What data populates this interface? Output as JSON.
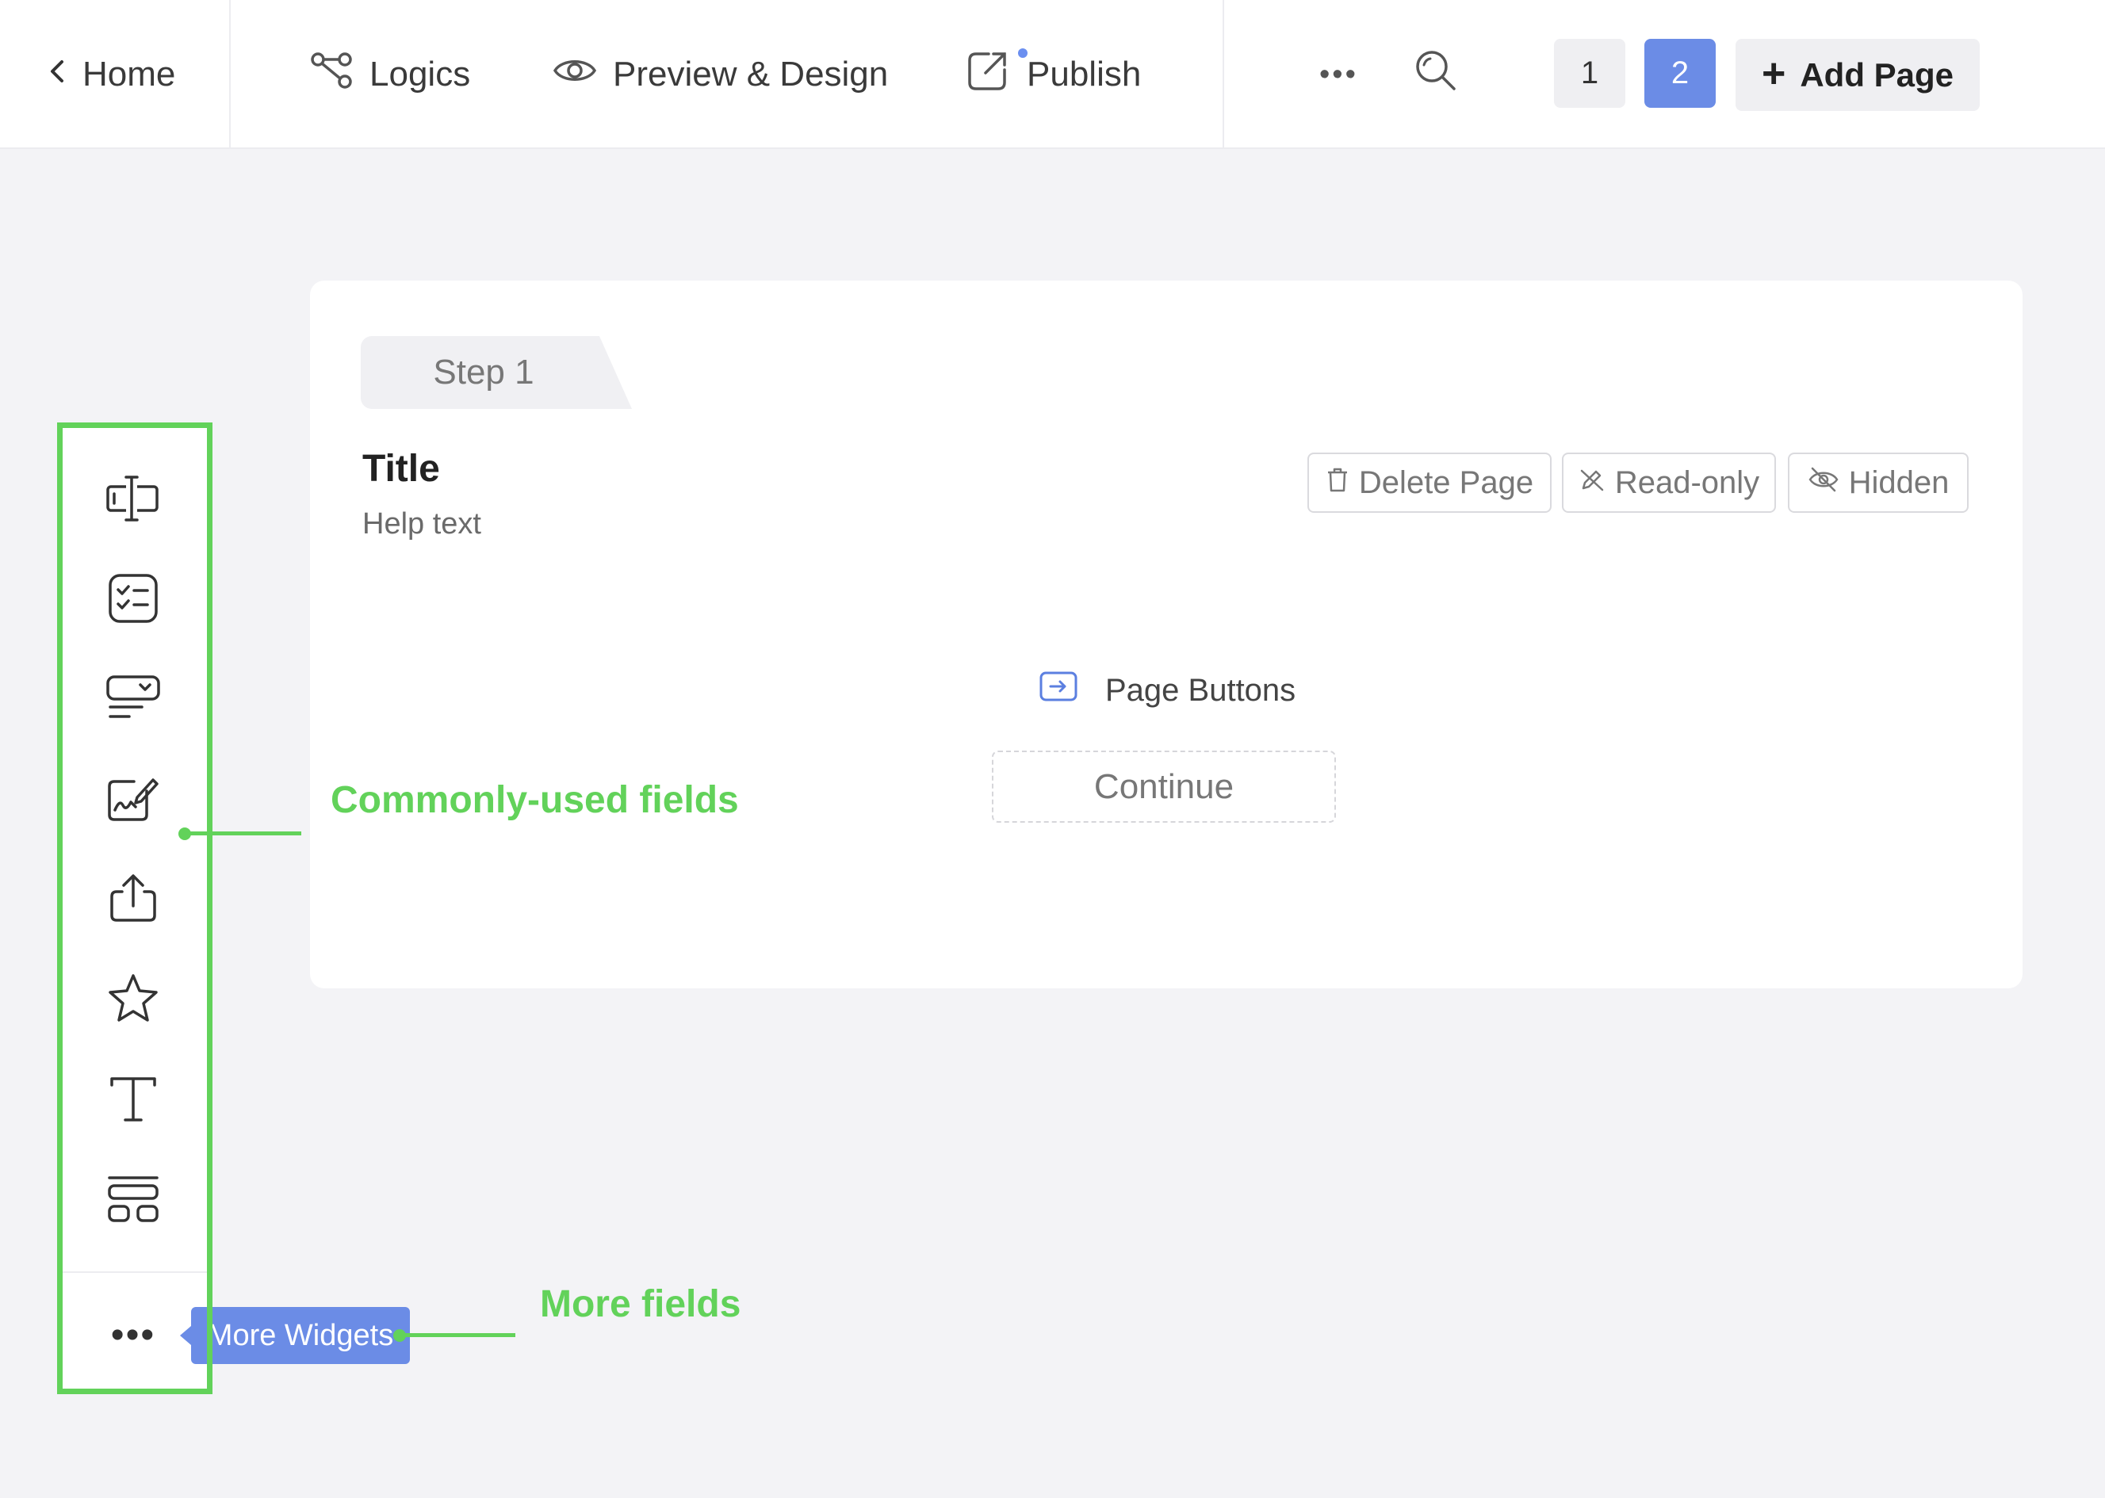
{
  "header": {
    "home_label": "Home",
    "nav": [
      {
        "label": "Logics",
        "icon": "share-nodes-icon"
      },
      {
        "label": "Preview & Design",
        "icon": "eye-icon"
      },
      {
        "label": "Publish",
        "icon": "external-link-icon"
      }
    ],
    "more_label": "•••",
    "pages": [
      "1",
      "2"
    ],
    "active_page": "2",
    "add_page_label": "Add Page"
  },
  "canvas": {
    "step_label": "Step 1",
    "title": "Title",
    "help_text": "Help text",
    "actions": [
      {
        "label": "Delete Page",
        "icon": "trash-icon"
      },
      {
        "label": "Read-only",
        "icon": "pencil-off-icon"
      },
      {
        "label": "Hidden",
        "icon": "eye-off-icon"
      }
    ],
    "page_buttons_label": "Page Buttons",
    "continue_label": "Continue"
  },
  "toolbar": {
    "icons": [
      "text-input-icon",
      "checklist-icon",
      "dropdown-icon",
      "signature-icon",
      "upload-icon",
      "star-icon",
      "text-icon",
      "layout-icon"
    ],
    "more_label": "•••",
    "tooltip": "More Widgets"
  },
  "annotations": {
    "common": "Commonly-used fields",
    "more": "More fields",
    "color": "#62d25a"
  },
  "colors": {
    "accent": "#6b8ce6",
    "annotation": "#62d25a",
    "background": "#f3f3f6"
  }
}
